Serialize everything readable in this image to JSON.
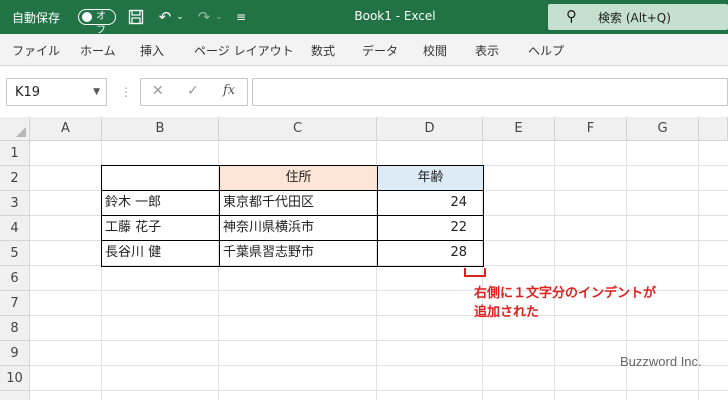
{
  "titlebar": {
    "autosave_label": "自動保存",
    "toggle_label": "オフ",
    "title": "Book1  -  Excel",
    "search_label": "検索 (Alt+Q)"
  },
  "menu": [
    "ファイル",
    "ホーム",
    "挿入",
    "ページ レイアウト",
    "数式",
    "データ",
    "校閲",
    "表示",
    "ヘルプ"
  ],
  "formula_bar": {
    "name_box": "K19",
    "fx_label": "fx",
    "formula": ""
  },
  "columns": [
    "A",
    "B",
    "C",
    "D",
    "E",
    "F",
    "G"
  ],
  "rows": [
    "1",
    "2",
    "3",
    "4",
    "5",
    "6",
    "7",
    "8",
    "9",
    "10"
  ],
  "table": {
    "header": {
      "address": "住所",
      "age": "年齢"
    },
    "rows": [
      {
        "name": "鈴木 一郎",
        "address": "東京都千代田区",
        "age": "24"
      },
      {
        "name": "工藤 花子",
        "address": "神奈川県横浜市",
        "age": "22"
      },
      {
        "name": "長谷川 健",
        "address": "千葉県習志野市",
        "age": "28"
      }
    ],
    "colors": {
      "address_header_bg": "#fce4d6",
      "age_header_bg": "#ddebf7"
    }
  },
  "annotation": {
    "line1": "右側に１文字分のインデントが",
    "line2": "追加された",
    "color": "#e0201c"
  },
  "watermark": "Buzzword Inc.",
  "colors": {
    "title_bar": "#217346",
    "search_bg": "#c6e0cf"
  }
}
